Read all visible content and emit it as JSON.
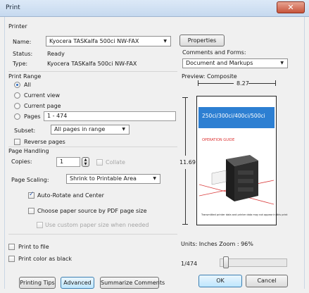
{
  "window": {
    "title": "Print",
    "close_icon": "✕"
  },
  "printer": {
    "section_label": "Printer",
    "name_label": "Name:",
    "name_value": "Kyocera TASKalfa 500ci NW-FAX",
    "status_label": "Status:",
    "status_value": "Ready",
    "type_label": "Type:",
    "type_value": "Kyocera TASKalfa 500ci NW-FAX",
    "properties_button": "Properties",
    "comments_label": "Comments and Forms:",
    "comments_value": "Document and Markups"
  },
  "print_range": {
    "section_label": "Print Range",
    "all_label": "All",
    "current_view_label": "Current view",
    "current_page_label": "Current page",
    "pages_label": "Pages",
    "pages_value": "1 - 474",
    "subset_label": "Subset:",
    "subset_value": "All pages in range",
    "reverse_label": "Reverse pages",
    "selected": "All"
  },
  "page_handling": {
    "section_label": "Page Handling",
    "copies_label": "Copies:",
    "copies_value": "1",
    "collate_label": "Collate",
    "scaling_label": "Page Scaling:",
    "scaling_value": "Shrink to Printable Area",
    "auto_rotate_label": "Auto-Rotate and Center",
    "choose_source_label": "Choose paper source by PDF page size",
    "custom_paper_label": "Use custom paper size when needed"
  },
  "options": {
    "print_to_file_label": "Print to file",
    "print_black_label": "Print color as black"
  },
  "preview": {
    "section_label": "Preview: Composite",
    "width_value": "8.27",
    "height_value": "11.69",
    "cover_title": "250ci/300ci/400ci/500ci",
    "cover_guide": "OPERATION GUIDE",
    "cover_footer": "Transmitted printer data and printer data may not appear in this print",
    "units_text": "Units: Inches Zoom : 96%",
    "page_counter": "1/474"
  },
  "buttons": {
    "printing_tips": "Printing Tips",
    "advanced": "Advanced",
    "summarize": "Summarize Comments",
    "ok": "OK",
    "cancel": "Cancel"
  },
  "colors": {
    "accent": "#2d7fd2",
    "close": "#c7553c"
  }
}
